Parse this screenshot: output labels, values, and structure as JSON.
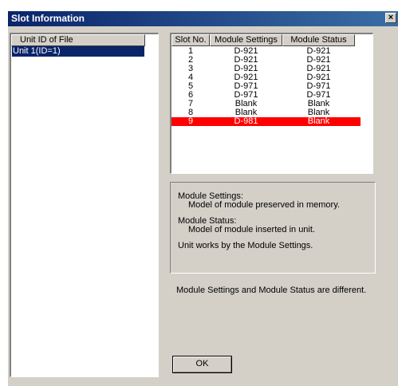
{
  "window": {
    "title": "Slot Information",
    "close_label": "×"
  },
  "unit_list": {
    "header": "Unit ID of File",
    "items": [
      "Unit 1(ID=1)"
    ]
  },
  "slot_table": {
    "headers": [
      "Slot No.",
      "Module Settings",
      "Module Status"
    ],
    "rows": [
      [
        "1",
        "D-921",
        "D-921"
      ],
      [
        "2",
        "D-921",
        "D-921"
      ],
      [
        "3",
        "D-921",
        "D-921"
      ],
      [
        "4",
        "D-921",
        "D-921"
      ],
      [
        "5",
        "D-971",
        "D-971"
      ],
      [
        "6",
        "D-971",
        "D-971"
      ],
      [
        "7",
        "Blank",
        "Blank"
      ],
      [
        "8",
        "Blank",
        "Blank"
      ],
      [
        "9",
        "D-981",
        "Blank"
      ]
    ],
    "highlight_color": "#ff0000"
  },
  "info": {
    "settings_title": "Module Settings:",
    "settings_desc": "Model of module preserved in memory.",
    "status_title": "Module Status:",
    "status_desc": "Model of module inserted in unit.",
    "works_by": "Unit works by the Module Settings."
  },
  "difference_message": "Module Settings and Module Status are different.",
  "ok_label": "OK"
}
